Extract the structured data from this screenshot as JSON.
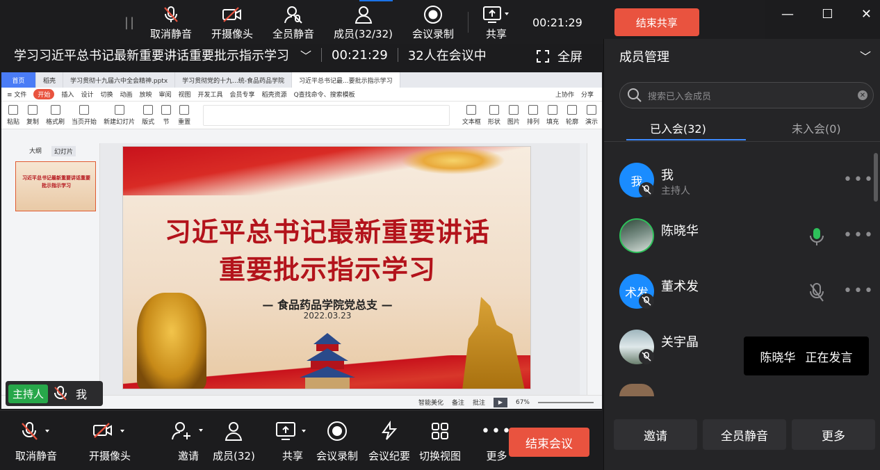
{
  "share_bar": {
    "unmute_label": "取消静音",
    "camera_label": "开摄像头",
    "mute_all_label": "全员静音",
    "members_label": "成员(32/32)",
    "record_label": "会议录制",
    "share_label": "共享",
    "timer": "00:21:29",
    "end_share_label": "结束共享"
  },
  "meeting": {
    "title": "学习习近平总书记最新重要讲话重要批示指示学习",
    "timer": "00:21:29",
    "participants_text": "32人在会议中",
    "fullscreen_label": "全屏"
  },
  "wps": {
    "tabs": [
      "首页",
      "稻壳",
      "学习贯彻十九届六中全会精神.pptx",
      "学习贯彻党的十九...统-食品药品学院",
      "习近平总书记最...要批示指示学习"
    ],
    "menu": [
      "≡ 文件",
      "开始",
      "插入",
      "设计",
      "切换",
      "动画",
      "放映",
      "审阅",
      "视图",
      "开发工具",
      "会员专享",
      "稻壳资源",
      "Q查找命令、搜索模板"
    ],
    "menu_right": [
      "上协作",
      "分享"
    ],
    "ribbon": [
      "粘贴",
      "复制",
      "格式刷",
      "当页开始",
      "新建幻灯片",
      "版式",
      "节",
      "重置",
      "文本框",
      "形状",
      "图片",
      "排列",
      "填充",
      "轮廓",
      "演示"
    ],
    "panel_tabs": [
      "大纲",
      "幻灯片"
    ],
    "thumb_title": "习近平总书记最新重要讲话重要批示指示学习",
    "slide_title_1": "习近平总书记最新重要讲话",
    "slide_title_2": "重要批示指示学习",
    "slide_org": "— 食品药品学院党总支 —",
    "slide_date": "2022.03.23",
    "status": [
      "智能美化",
      "备注",
      "批注",
      "67%"
    ]
  },
  "host_overlay": {
    "role": "主持人",
    "name": "我"
  },
  "bottom_bar": {
    "unmute": "取消静音",
    "camera": "开摄像头",
    "invite": "邀请",
    "members": "成员(32)",
    "share": "共享",
    "record": "会议录制",
    "minutes": "会议纪要",
    "switch_view": "切换视图",
    "more": "更多",
    "end_meeting": "结束会议"
  },
  "panel": {
    "title": "成员管理",
    "search_placeholder": "搜索已入会成员",
    "tab_joined": "已入会(32)",
    "tab_not_joined": "未入会(0)",
    "members": [
      {
        "avatar_text": "我",
        "name": "我",
        "role": "主持人"
      },
      {
        "avatar_text": "",
        "name": "陈晓华",
        "role": ""
      },
      {
        "avatar_text": "术发",
        "name": "董术发",
        "role": ""
      },
      {
        "avatar_text": "",
        "name": "关宇晶",
        "role": ""
      }
    ],
    "speaking_name": "陈晓华",
    "speaking_text": "正在发言",
    "invite": "邀请",
    "mute_all": "全员静音",
    "more": "更多"
  },
  "colors": {
    "accent_red": "#e9533f",
    "accent_blue": "#3d8bff",
    "host_green": "#27a74a",
    "avatar_blue": "#1a8cff",
    "active_mic_green": "#2ec05a"
  }
}
